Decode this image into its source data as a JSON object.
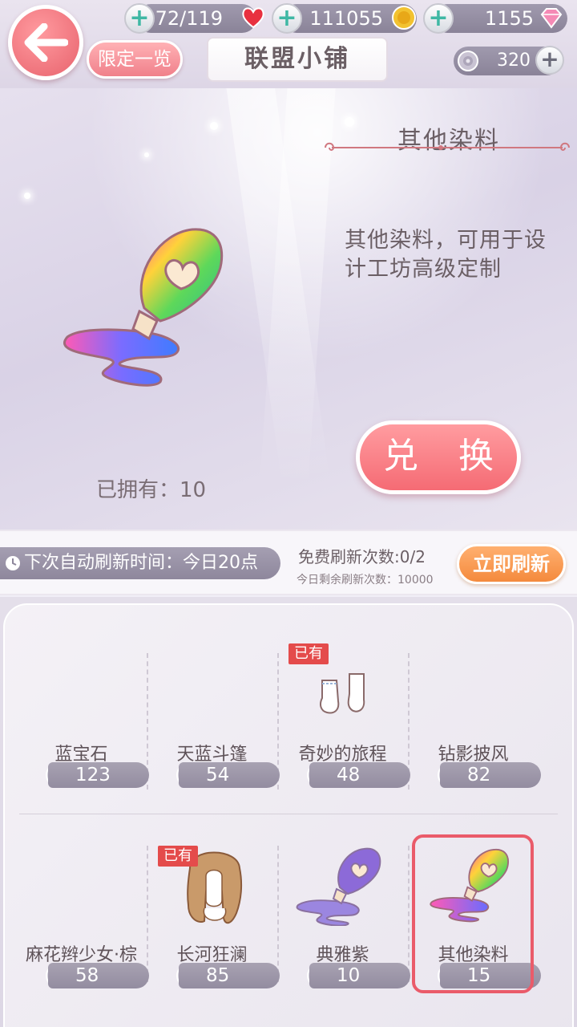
{
  "header": {
    "title": "联盟小铺",
    "limited_button": "限定一览",
    "stamina": "172/119",
    "gold": "111055",
    "diamonds": "1155",
    "roses": "320"
  },
  "detail": {
    "item_name": "其他染料",
    "description_line1": "其他染料，可用于设",
    "description_line2": "计工坊高级定制",
    "owned_label": "已拥有：10",
    "exchange_button": "兑 换"
  },
  "refresh": {
    "next_refresh": "下次自动刷新时间：今日20点",
    "free_refresh": "免费刷新次数:0/2",
    "remaining": "今日剩余刷新次数：10000",
    "refresh_button": "立即刷新"
  },
  "shop": {
    "owned_badge": "已有",
    "items": [
      {
        "name": "蓝宝石",
        "price": "123"
      },
      {
        "name": "天蓝斗篷",
        "price": "54"
      },
      {
        "name": "奇妙的旅程",
        "price": "48"
      },
      {
        "name": "钻影披风",
        "price": "82"
      },
      {
        "name": "麻花辫少女·棕",
        "price": "58"
      },
      {
        "name": "长河狂澜",
        "price": "85"
      },
      {
        "name": "典雅紫",
        "price": "10"
      },
      {
        "name": "其他染料",
        "price": "15"
      }
    ]
  },
  "colors": {
    "accent_red": "#f56b74",
    "accent_orange": "#f48a3d",
    "pill_gray": "#938ca0",
    "badge_red": "#e44b4b"
  }
}
